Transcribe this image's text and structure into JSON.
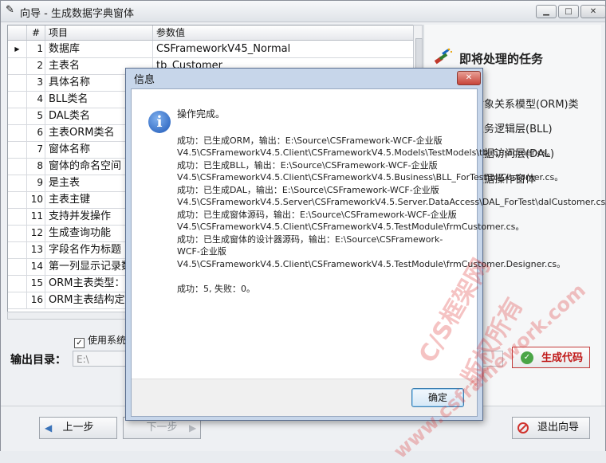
{
  "window": {
    "title": "向导 - 生成数据字典窗体",
    "icon": "wizard-wand-icon"
  },
  "grid": {
    "columns": [
      "#",
      "项目",
      "参数值"
    ],
    "rows": [
      {
        "num": "1",
        "item": "数据库",
        "value": "CSFrameworkV45_Normal",
        "current": true
      },
      {
        "num": "2",
        "item": "主表名",
        "value": "tb_Customer"
      },
      {
        "num": "3",
        "item": "具体名称",
        "value": ""
      },
      {
        "num": "4",
        "item": "BLL类名",
        "value": ""
      },
      {
        "num": "5",
        "item": "DAL类名",
        "value": ""
      },
      {
        "num": "6",
        "item": "主表ORM类名",
        "value": ""
      },
      {
        "num": "7",
        "item": "窗体名称",
        "value": ""
      },
      {
        "num": "8",
        "item": "窗体的命名空间",
        "value": ""
      },
      {
        "num": "9",
        "item": "是主表",
        "value": ""
      },
      {
        "num": "10",
        "item": "主表主键",
        "value": ""
      },
      {
        "num": "11",
        "item": "支持并发操作",
        "value": ""
      },
      {
        "num": "12",
        "item": "生成查询功能",
        "value": ""
      },
      {
        "num": "13",
        "item": "字段名作为标题",
        "value": ""
      },
      {
        "num": "14",
        "item": "第一列显示记录数",
        "value": ""
      },
      {
        "num": "15",
        "item": "ORM主表类型：",
        "value": ""
      },
      {
        "num": "16",
        "item": "ORM主表结构定义",
        "value": ""
      }
    ]
  },
  "tasks": {
    "title": "即将处理的任务",
    "items": [
      "对象关系模型(ORM)类",
      "业务逻辑层(BLL)",
      "数据访问层(DAL)",
      "数据操作窗体"
    ]
  },
  "options": {
    "use_system_label": "使用系统默"
  },
  "output": {
    "label": "输出目录：",
    "value": "E:\\"
  },
  "buttons": {
    "generate": "生成代码",
    "prev": "上一步",
    "next": "下一步",
    "exit": "退出向导"
  },
  "dialog": {
    "title": "信息",
    "close": "✕",
    "heading": "操作完成。",
    "lines": [
      "成功：已生成ORM，输出：E:\\Source\\CSFramework-WCF-企业版V4.5\\CSFrameworkV4.5.Client\\CSFrameworkV4.5.Models\\TestModels\\tb_Customer.cs。",
      "成功：已生成BLL，输出：E:\\Source\\CSFramework-WCF-企业版V4.5\\CSFrameworkV4.5.Client\\CSFrameworkV4.5.Business\\BLL_ForTest\\bllCustomer.cs。",
      "成功：已生成DAL，输出：E:\\Source\\CSFramework-WCF-企业版V4.5\\CSFrameworkV4.5.Server\\CSFrameworkV4.5.Server.DataAccess\\DAL_ForTest\\dalCustomer.cs。",
      "成功：已生成窗体源码，输出：E:\\Source\\CSFramework-WCF-企业版V4.5\\CSFrameworkV4.5.Client\\CSFrameworkV4.5.TestModule\\frmCustomer.cs。",
      "成功：已生成窗体的设计器源码，输出：E:\\Source\\CSFramework-WCF-企业版V4.5\\CSFrameworkV4.5.Client\\CSFrameworkV4.5.TestModule\\frmCustomer.Designer.cs。"
    ],
    "summary": "成功：5, 失败：0。",
    "ok": "确定",
    "icon": "info-icon"
  },
  "watermark": {
    "line1": "C/S框架网",
    "line2": "版权所有",
    "line3": "www.csframework.com"
  }
}
